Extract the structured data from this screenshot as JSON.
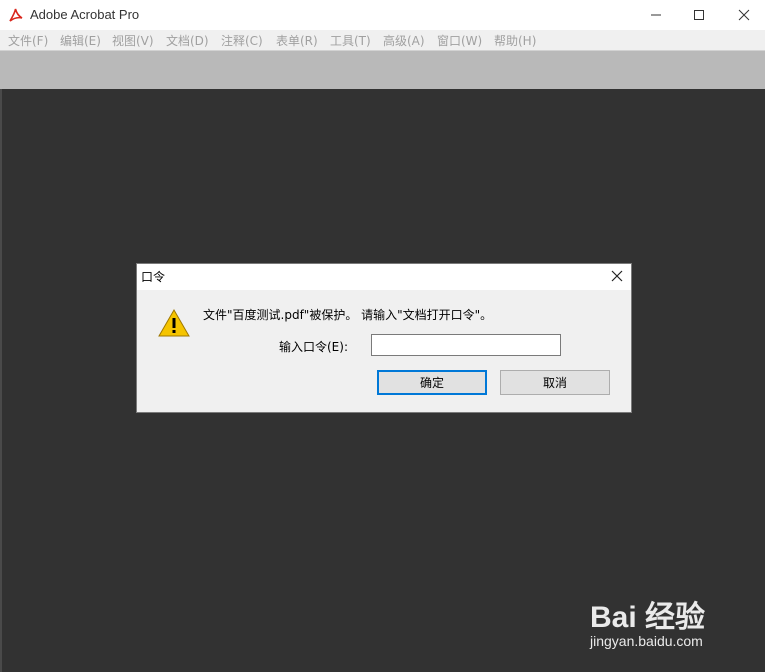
{
  "window": {
    "title": "Adobe Acrobat Pro",
    "icon": "acrobat-logo-icon",
    "controls": [
      "minimize-icon",
      "maximize-icon",
      "close-icon"
    ]
  },
  "menubar": {
    "items": [
      {
        "label": "文件(F)"
      },
      {
        "label": "编辑(E)"
      },
      {
        "label": "视图(V)"
      },
      {
        "label": "文档(D)"
      },
      {
        "label": "注释(C)"
      },
      {
        "label": "表单(R)"
      },
      {
        "label": "工具(T)"
      },
      {
        "label": "高级(A)"
      },
      {
        "label": "窗口(W)"
      },
      {
        "label": "帮助(H)"
      }
    ]
  },
  "dialog": {
    "title": "口令",
    "icon": "warning-icon",
    "message": "文件\"百度测试.pdf\"被保护。 请输入\"文档打开口令\"。",
    "password_label": "输入口令(E):",
    "password_value": "",
    "ok_label": "确定",
    "cancel_label": "取消"
  },
  "watermark": {
    "brand": "Bai 经验",
    "url": "jingyan.baidu.com"
  },
  "colors": {
    "workspace": "#323232",
    "toolbar": "#b9b9b9",
    "menubar": "#f0f0f0",
    "focus_border": "#0078d7",
    "acrobat_red": "#d9261c",
    "warning_yellow": "#f5c400"
  }
}
